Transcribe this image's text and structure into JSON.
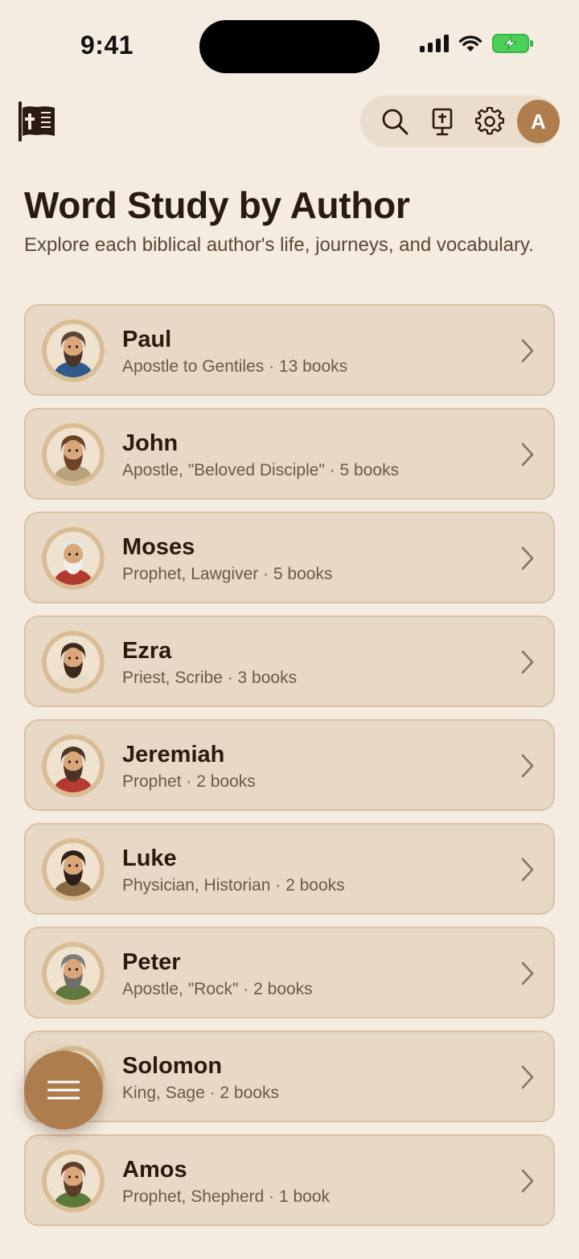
{
  "status_bar": {
    "time": "9:41"
  },
  "header": {
    "user_initial": "A",
    "icons": [
      "app-logo-icon",
      "search-icon",
      "bible-icon",
      "gear-icon"
    ]
  },
  "page": {
    "title": "Word Study by Author",
    "subtitle": "Explore each biblical author's life, journeys, and vocabulary."
  },
  "authors": [
    {
      "name": "Paul",
      "description": "Apostle to Gentiles · 13 books",
      "robe": "#2f5a8a",
      "hair": "#5b4434",
      "beard": "#4a3628"
    },
    {
      "name": "John",
      "description": "Apostle, \"Beloved Disciple\" · 5 books",
      "robe": "#b8a27c",
      "hair": "#6b4428",
      "beard": "#6b4428"
    },
    {
      "name": "Moses",
      "description": "Prophet, Lawgiver · 5 books",
      "robe": "#b33a30",
      "hair": "#e6e6e2",
      "beard": "#f0f0ec"
    },
    {
      "name": "Ezra",
      "description": "Priest, Scribe · 3 books",
      "robe": "#e8dcc4",
      "hair": "#3e2b1f",
      "beard": "#3e2b1f"
    },
    {
      "name": "Jeremiah",
      "description": "Prophet · 2 books",
      "robe": "#b73a32",
      "hair": "#4c3526",
      "beard": "#4c3526"
    },
    {
      "name": "Luke",
      "description": "Physician, Historian · 2 books",
      "robe": "#8a6a44",
      "hair": "#2e2119",
      "beard": "#2e2119"
    },
    {
      "name": "Peter",
      "description": "Apostle, \"Rock\" · 2 books",
      "robe": "#5f7a3c",
      "hair": "#7d7d78",
      "beard": "#6f6f69"
    },
    {
      "name": "Solomon",
      "description": "King, Sage · 2 books",
      "robe": "#8a3a5a",
      "hair": "#3e2b1f",
      "beard": "#3e2b1f"
    },
    {
      "name": "Amos",
      "description": "Prophet, Shepherd · 1 book",
      "robe": "#5d7a3a",
      "hair": "#5a3e2a",
      "beard": "#5a3e2a"
    }
  ],
  "colors": {
    "background": "#f4ebe1",
    "card": "#e8d9c6",
    "card_border": "#d9c1a2",
    "accent": "#ad7d4e"
  }
}
